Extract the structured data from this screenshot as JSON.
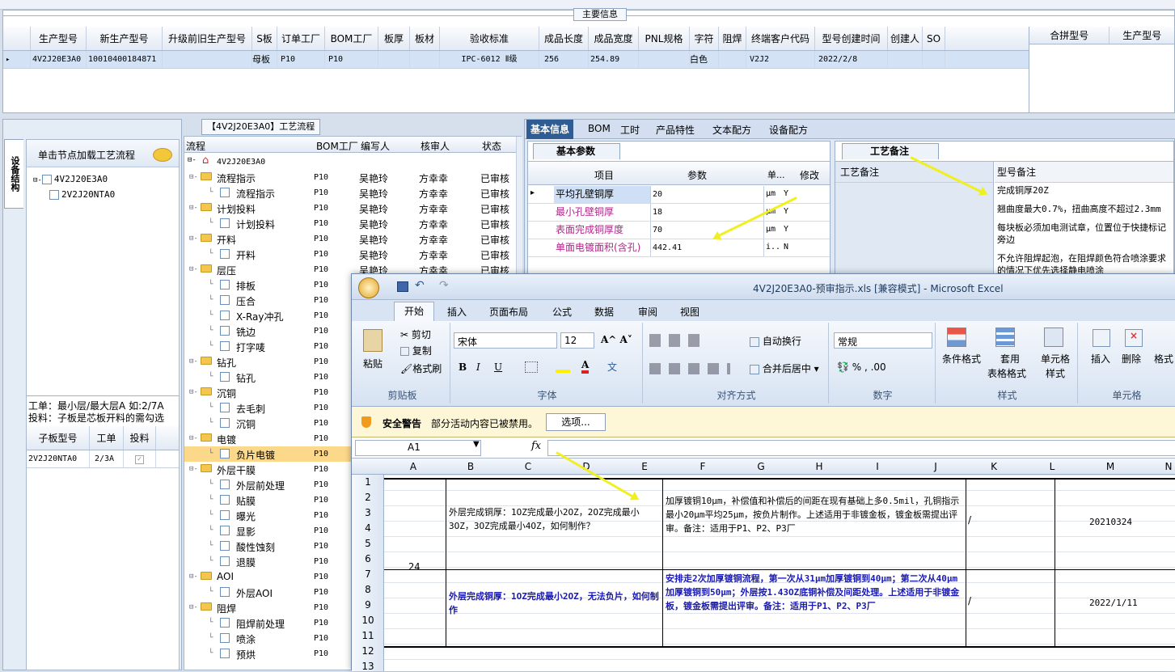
{
  "main_info": {
    "title": "主要信息",
    "columns": [
      "生产型号",
      "新生产型号",
      "升级前旧生产型号",
      "S板",
      "订单工厂",
      "BOM工厂",
      "板厚",
      "板材",
      "验收标准",
      "成品长度",
      "成品宽度",
      "PNL规格",
      "字符",
      "阻焊",
      "终端客户代码",
      "型号创建时间",
      "创建人",
      "SO"
    ],
    "row": {
      "c1": "4V2J20E3A0",
      "c2": "10010400184871",
      "c4": "母板",
      "c5": "P10",
      "c6": "P10",
      "c9": "IPC-6012 Ⅱ级",
      "c10": "256",
      "c11": "254.89",
      "c13": "白色",
      "c15": "V2J2",
      "c16": "2022/2/8"
    },
    "right_columns": [
      "合拼型号",
      "生产型号"
    ]
  },
  "left_panel": {
    "vtab": "设备结构",
    "hint": "单击节点加载工艺流程",
    "tree": [
      "4V2J20E3A0",
      "2V2J20NTA0"
    ],
    "note1": "工单：最小层/最大层A 如:2/7A",
    "note2": "投料：子板是芯板开料的需勾选",
    "table_headers": [
      "子板型号",
      "工单",
      "投料"
    ],
    "table_row": {
      "model": "2V2J20NTA0",
      "order": "2/3A"
    }
  },
  "process": {
    "title": "【4V2J20E3A0】工艺流程",
    "headers": [
      "流程",
      "BOM工厂",
      "编写人",
      "核审人",
      "状态"
    ],
    "root": "4V2J20E3A0",
    "rows": [
      {
        "n": "流程指示",
        "l": 1
      },
      {
        "n": "流程指示",
        "l": 2
      },
      {
        "n": "计划投料",
        "l": 1
      },
      {
        "n": "计划投料",
        "l": 2
      },
      {
        "n": "开料",
        "l": 1
      },
      {
        "n": "开料",
        "l": 2
      },
      {
        "n": "层压",
        "l": 1
      },
      {
        "n": "排板",
        "l": 2
      },
      {
        "n": "压合",
        "l": 2
      },
      {
        "n": "X-Ray冲孔",
        "l": 2
      },
      {
        "n": "铣边",
        "l": 2
      },
      {
        "n": "打字唛",
        "l": 2
      },
      {
        "n": "钻孔",
        "l": 1
      },
      {
        "n": "钻孔",
        "l": 2
      },
      {
        "n": "沉铜",
        "l": 1
      },
      {
        "n": "去毛刺",
        "l": 2
      },
      {
        "n": "沉铜",
        "l": 2
      },
      {
        "n": "电镀",
        "l": 1
      },
      {
        "n": "负片电镀",
        "l": 2
      },
      {
        "n": "外层干膜",
        "l": 1
      },
      {
        "n": "外层前处理",
        "l": 2
      },
      {
        "n": "贴膜",
        "l": 2
      },
      {
        "n": "曝光",
        "l": 2
      },
      {
        "n": "显影",
        "l": 2
      },
      {
        "n": "酸性蚀刻",
        "l": 2
      },
      {
        "n": "退膜",
        "l": 2
      },
      {
        "n": "AOI",
        "l": 1
      },
      {
        "n": "外层AOI",
        "l": 2
      },
      {
        "n": "阻焊",
        "l": 1
      },
      {
        "n": "阻焊前处理",
        "l": 2
      },
      {
        "n": "喷涂",
        "l": 2
      },
      {
        "n": "预烘",
        "l": 2
      }
    ],
    "bom": "P10",
    "writer": "吴艳玲",
    "reviewer": "方幸幸",
    "status": "已审核"
  },
  "right": {
    "tabs": [
      "基本信息",
      "BOM",
      "工时",
      "产品特性",
      "文本配方",
      "设备配方"
    ],
    "basic_title": "基本参数",
    "basic_headers": [
      "项目",
      "参数",
      "单...",
      "修改"
    ],
    "basic_rows": [
      {
        "item": "平均孔壁铜厚",
        "val": "20",
        "unit": "μm",
        "mod": "Y"
      },
      {
        "item": "最小孔壁铜厚",
        "val": "18",
        "unit": "μm",
        "mod": "Y"
      },
      {
        "item": "表面完成铜厚度",
        "val": "70",
        "unit": "μm",
        "mod": "Y"
      },
      {
        "item": "单面电镀面积(含孔)",
        "val": "442.41",
        "unit": "i..",
        "mod": "N"
      }
    ],
    "remark_title": "工艺备注",
    "remark_headers": [
      "工艺备注",
      "型号备注"
    ],
    "remarks": [
      "完成铜厚20Z",
      "翘曲度最大0.7%，扭曲高度不超过2.3mm",
      "每块板必须加电测试章，位置位于快捷标记旁边",
      "不允许阻焊起泡，在阻焊颜色符合喷涂要求的情况下优先选择静电喷涂"
    ]
  },
  "excel": {
    "title": "4V2J20E3A0-预审指示.xls  [兼容模式] - Microsoft Excel",
    "tabs": [
      "开始",
      "插入",
      "页面布局",
      "公式",
      "数据",
      "审阅",
      "视图"
    ],
    "clip": {
      "paste": "粘贴",
      "cut": "剪切",
      "copy": "复制",
      "fmt": "格式刷",
      "label": "剪贴板"
    },
    "font": {
      "name": "宋体",
      "size": "12",
      "label": "字体"
    },
    "align": {
      "wrap": "自动换行",
      "merge": "合并后居中",
      "label": "对齐方式"
    },
    "number": {
      "fmt": "常规",
      "label": "数字"
    },
    "styles": {
      "cond": "条件格式",
      "table": "套用",
      "table2": "表格格式",
      "cell": "单元格",
      "cell2": "样式",
      "label": "样式"
    },
    "cells_grp": {
      "insert": "插入",
      "delete": "删除",
      "format": "格式",
      "label": "单元格"
    },
    "security": {
      "title": "安全警告",
      "msg": "部分活动内容已被禁用。",
      "btn": "选项..."
    },
    "namebox": "A1",
    "cols": [
      "A",
      "B",
      "C",
      "D",
      "E",
      "F",
      "G",
      "H",
      "I",
      "J",
      "K",
      "L",
      "M",
      "N"
    ],
    "rows": [
      "1",
      "2",
      "3",
      "4",
      "5",
      "6",
      "7",
      "8",
      "9",
      "10",
      "11",
      "12",
      "13"
    ],
    "no": "24",
    "q1": "外层完成铜厚：1OZ完成最小2OZ，2OZ完成最小3OZ，3OZ完成最小4OZ，如何制作？",
    "a1": "加厚镀铜10μm，补偿值和补偿后的间距在现有基础上多0.5mil，孔铜指示最小20μm平均25μm，按负片制作。上述适用于非镀金板，镀金板需提出评审。备注：适用于P1、P2、P3厂",
    "s1": "/",
    "d1": "20210324",
    "q2": "外层完成铜厚：1OZ完成最小2OZ，无法负片，如何制作",
    "a2": "安排走2次加厚镀铜流程，第一次从31μm加厚镀铜到40μm；第二次从40μm加厚镀铜到50μm；外层按1.43OZ底铜补偿及间距处理。上述适用于非镀金板，镀金板需提出评审。备注：适用于P1、P2、P3厂",
    "s2": "/",
    "d2": "2022/1/11"
  }
}
